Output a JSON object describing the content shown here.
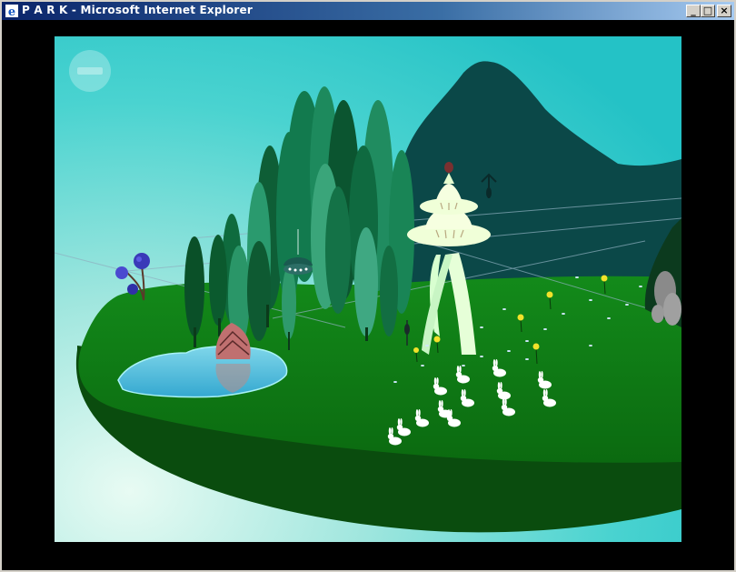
{
  "window": {
    "title": "P A R K - Microsoft Internet Explorer",
    "minimize_glyph": "_",
    "maximize_glyph": "□",
    "close_glyph": "×"
  },
  "icons": {
    "app": "internet-explorer-icon",
    "minimize": "minimize-icon",
    "maximize": "maximize-icon",
    "close": "close-icon",
    "zoom_out": "minus-icon"
  },
  "colors": {
    "sky_top": "#2ec6c6",
    "sky_glow": "#d4f4ee",
    "grass": "#0e6b12",
    "island_side": "#0a4a0e",
    "mountain": "#0c4b4b",
    "tower": "#e6ffcc",
    "pond": "#49b8d8"
  }
}
